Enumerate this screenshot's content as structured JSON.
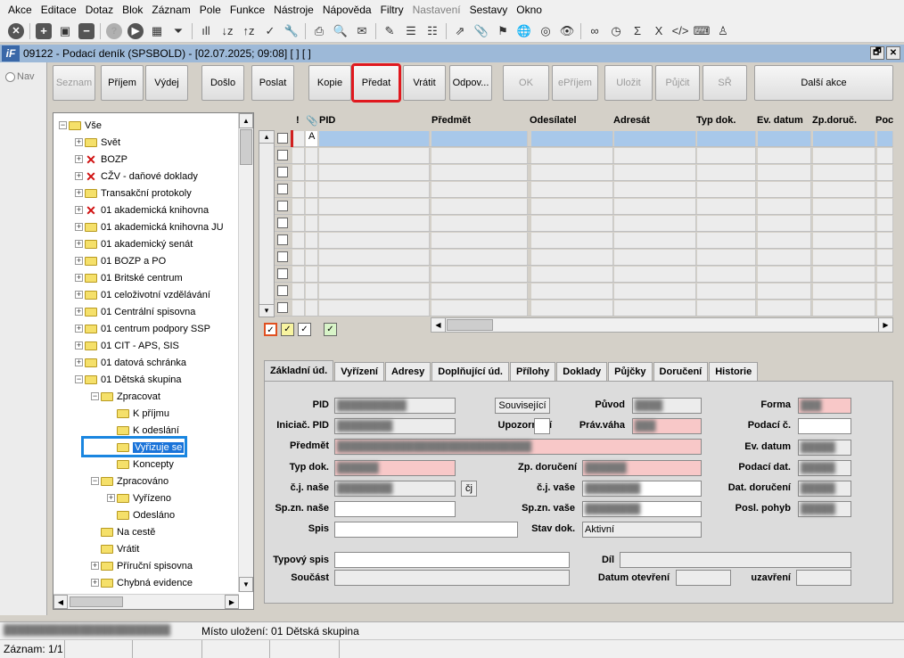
{
  "menu": [
    "Akce",
    "Editace",
    "Dotaz",
    "Blok",
    "Záznam",
    "Pole",
    "Funkce",
    "Nástroje",
    "Nápověda",
    "Filtry",
    "Nastavení",
    "Sestavy",
    "Okno"
  ],
  "menu_disabled": [
    "Nastavení"
  ],
  "nav_label": "Nav",
  "window": {
    "logo": "iF",
    "title": "09122 - Podací deník (SPSBOLD) - [02.07.2025; 09:08] [ ] [ ]",
    "restore": "🗗",
    "close": "✕"
  },
  "actions": [
    {
      "label": "Seznam",
      "disabled": true
    },
    {
      "label": "Příjem",
      "disabled": false
    },
    {
      "label": "Výdej",
      "disabled": false
    },
    {
      "label": "Došlo",
      "disabled": false
    },
    {
      "label": "Poslat",
      "disabled": false
    },
    {
      "label": "Kopie",
      "disabled": false
    },
    {
      "label": "Předat",
      "disabled": false,
      "highlighted": true
    },
    {
      "label": "Vrátit",
      "disabled": false
    },
    {
      "label": "Odpov...",
      "disabled": false
    },
    {
      "label": "OK",
      "disabled": true
    },
    {
      "label": "ePříjem",
      "disabled": true
    },
    {
      "label": "Uložit",
      "disabled": true
    },
    {
      "label": "Půjčit",
      "disabled": true
    },
    {
      "label": "SŘ",
      "disabled": true
    },
    {
      "label": "Další akce",
      "disabled": false
    }
  ],
  "tree": [
    {
      "label": "Vše",
      "type": "folder",
      "expander": "−"
    },
    {
      "label": "Svět",
      "type": "folder",
      "expander": "+"
    },
    {
      "label": "BOZP",
      "type": "x",
      "expander": "+"
    },
    {
      "label": "CŽV - daňové doklady",
      "type": "x",
      "expander": "+"
    },
    {
      "label": "Transakční protokoly",
      "type": "folder",
      "expander": "+"
    },
    {
      "label": "01 akademická knihovna",
      "type": "x",
      "expander": "+"
    },
    {
      "label": "01 akademická knihovna JU",
      "type": "folder",
      "expander": "+"
    },
    {
      "label": "01 akademický senát",
      "type": "folder",
      "expander": "+"
    },
    {
      "label": "01 BOZP a PO",
      "type": "folder",
      "expander": "+"
    },
    {
      "label": "01 Britské centrum",
      "type": "folder",
      "expander": "+"
    },
    {
      "label": "01 celoživotní vzdělávání",
      "type": "folder",
      "expander": "+"
    },
    {
      "label": "01 Centrální spisovna",
      "type": "folder",
      "expander": "+"
    },
    {
      "label": "01 centrum podpory SSP",
      "type": "folder",
      "expander": "+"
    },
    {
      "label": "01 CIT - APS, SIS",
      "type": "folder",
      "expander": "+"
    },
    {
      "label": "01 datová schránka",
      "type": "folder",
      "expander": "+"
    },
    {
      "label": "01 Dětská skupina",
      "type": "folder",
      "expander": "−"
    },
    {
      "label": "Zpracovat",
      "type": "folder",
      "expander": "−"
    },
    {
      "label": "K příjmu",
      "type": "folder",
      "expander": ""
    },
    {
      "label": "K odeslání",
      "type": "folder",
      "expander": ""
    },
    {
      "label": "Vyřizuje se",
      "type": "folder",
      "expander": "",
      "selected": true
    },
    {
      "label": "Koncepty",
      "type": "folder",
      "expander": ""
    },
    {
      "label": "Zpracováno",
      "type": "folder",
      "expander": "−"
    },
    {
      "label": "Vyřízeno",
      "type": "folder",
      "expander": "+"
    },
    {
      "label": "Odesláno",
      "type": "folder",
      "expander": ""
    },
    {
      "label": "Na cestě",
      "type": "folder",
      "expander": ""
    },
    {
      "label": "Vrátit",
      "type": "folder",
      "expander": ""
    },
    {
      "label": "Příruční spisovna",
      "type": "folder",
      "expander": "+"
    },
    {
      "label": "Chybná evidence",
      "type": "folder",
      "expander": "+"
    }
  ],
  "grid": {
    "headers": [
      "!",
      "📎",
      "PID",
      "Předmět",
      "Odesílatel",
      "Adresát",
      "Typ dok.",
      "Ev. datum",
      "Zp.doruč.",
      "Poc"
    ],
    "first_row_flag": "A"
  },
  "tabs": [
    "Základní úd.",
    "Vyřízení",
    "Adresy",
    "Doplňující úd.",
    "Přílohy",
    "Doklady",
    "Půjčky",
    "Doručení",
    "Historie"
  ],
  "form": {
    "pid": "PID",
    "iniciac_pid": "Iniciač. PID",
    "predmet": "Předmět",
    "typ_dok": "Typ dok.",
    "cj_nase": "č.j. naše",
    "spzn_nase": "Sp.zn. naše",
    "spis": "Spis",
    "souvisejici": "Související",
    "upozorneni": "Upozornění",
    "zp_doruceni": "Zp. doručení",
    "cj_vase": "č.j. vaše",
    "spzn_vase": "Sp.zn. vaše",
    "stav_dok": "Stav dok.",
    "stav_dok_value": "Aktivní",
    "puvod": "Původ",
    "prav_vaha": "Práv.váha",
    "forma": "Forma",
    "podaci_c": "Podací č.",
    "ev_datum": "Ev. datum",
    "podaci_dat": "Podací dat.",
    "dat_doruceni": "Dat. doručení",
    "posl_pohyb": "Posl. pohyb",
    "cj_btn": "čj",
    "typovy_spis": "Typový spis",
    "dil": "Díl",
    "soucast": "Součást",
    "datum_otevreni": "Datum otevření",
    "uzavreni": "uzavření"
  },
  "status": {
    "mistu_ulozeni": "Místo uložení: 01 Dětská skupina",
    "zaznam": "Záznam: 1/1"
  }
}
